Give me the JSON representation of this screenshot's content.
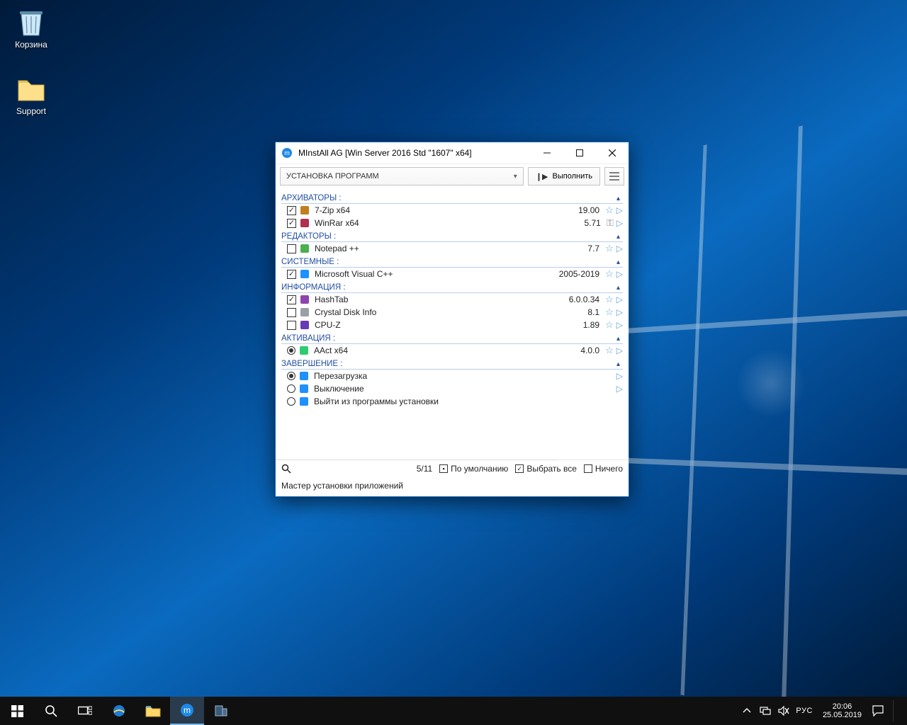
{
  "desktop": {
    "icons": [
      {
        "label": "Корзина",
        "icon": "recycle-bin-icon"
      },
      {
        "label": "Support",
        "icon": "folder-icon"
      }
    ]
  },
  "window": {
    "title": "MInstAll AG [Win Server 2016 Std \"1607\" x64]",
    "dropdown_label": "УСТАНОВКА ПРОГРАММ",
    "execute_label": "Выполнить",
    "status_text": "Мастер установки приложений",
    "counter": "5/11",
    "footer_default": "По умолчанию",
    "footer_select_all": "Выбрать все",
    "footer_none": "Ничего"
  },
  "sections": [
    {
      "title": "АРХИВАТОРЫ :",
      "mode": "checkbox",
      "items": [
        {
          "name": "7-Zip x64",
          "version": "19.00",
          "checked": true,
          "icon_color": "#c08020",
          "action": "star"
        },
        {
          "name": "WinRar x64",
          "version": "5.71",
          "checked": true,
          "icon_color": "#b03050",
          "action": "key"
        }
      ]
    },
    {
      "title": "РЕДАКТОРЫ :",
      "mode": "checkbox",
      "items": [
        {
          "name": "Notepad ++",
          "version": "7.7",
          "checked": false,
          "icon_color": "#4caf50",
          "action": "star"
        }
      ]
    },
    {
      "title": "СИСТЕМНЫЕ :",
      "mode": "checkbox",
      "items": [
        {
          "name": "Microsoft Visual C++",
          "version": "2005-2019",
          "checked": true,
          "icon_color": "#1e90ff",
          "action": "star"
        }
      ]
    },
    {
      "title": "ИНФОРМАЦИЯ :",
      "mode": "checkbox",
      "items": [
        {
          "name": "HashTab",
          "version": "6.0.0.34",
          "checked": true,
          "icon_color": "#8e44ad",
          "action": "star"
        },
        {
          "name": "Crystal Disk Info",
          "version": "8.1",
          "checked": false,
          "icon_color": "#9aa0a6",
          "action": "star"
        },
        {
          "name": "CPU-Z",
          "version": "1.89",
          "checked": false,
          "icon_color": "#673ab7",
          "action": "star"
        }
      ]
    },
    {
      "title": "АКТИВАЦИЯ :",
      "mode": "radio",
      "items": [
        {
          "name": "AAct x64",
          "version": "4.0.0",
          "checked": true,
          "icon_color": "#2ecc71",
          "action": "star"
        }
      ]
    },
    {
      "title": "ЗАВЕРШЕНИЕ :",
      "mode": "radio",
      "items": [
        {
          "name": "Перезагрузка",
          "version": "",
          "checked": true,
          "icon_color": "#1e90ff",
          "action": "play"
        },
        {
          "name": "Выключение",
          "version": "",
          "checked": false,
          "icon_color": "#1e90ff",
          "action": "play"
        },
        {
          "name": "Выйти из программы установки",
          "version": "",
          "checked": false,
          "icon_color": "#1e90ff",
          "action": "none"
        }
      ]
    }
  ],
  "footer_checks": {
    "default": true,
    "select_all": true,
    "none": false
  },
  "taskbar": {
    "lang": "РУС",
    "time": "20:06",
    "date": "25.05.2019"
  }
}
